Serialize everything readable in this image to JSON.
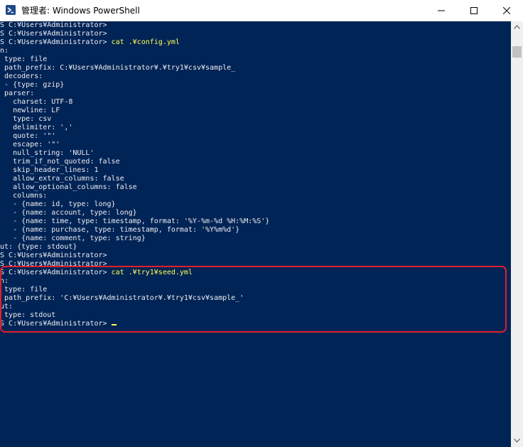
{
  "window": {
    "title": "管理者: Windows PowerShell",
    "icon": "powershell-icon",
    "controls": {
      "minimize_icon": "minimize-icon",
      "maximize_icon": "maximize-icon",
      "close_icon": "close-icon"
    }
  },
  "console": {
    "background": "#012456",
    "foreground": "#eeedf0",
    "command_color": "#ffff55",
    "highlight_color": "#e0202c",
    "lines": [
      {
        "prompt": "PS C:¥Users¥Administrator>",
        "cmd": ""
      },
      {
        "prompt": "PS C:¥Users¥Administrator>",
        "cmd": ""
      },
      {
        "prompt": "PS C:¥Users¥Administrator>",
        "cmd": " cat .¥config.yml"
      },
      {
        "text": "in:"
      },
      {
        "text": "  type: file"
      },
      {
        "text": "  path_prefix: C:¥Users¥Administrator¥.¥try1¥csv¥sample_"
      },
      {
        "text": "  decoders:"
      },
      {
        "text": "  - {type: gzip}"
      },
      {
        "text": "  parser:"
      },
      {
        "text": "    charset: UTF-8"
      },
      {
        "text": "    newline: LF"
      },
      {
        "text": "    type: csv"
      },
      {
        "text": "    delimiter: ','"
      },
      {
        "text": "    quote: '\"'"
      },
      {
        "text": "    escape: '\"'"
      },
      {
        "text": "    null_string: 'NULL'"
      },
      {
        "text": "    trim_if_not_quoted: false"
      },
      {
        "text": "    skip_header_lines: 1"
      },
      {
        "text": "    allow_extra_columns: false"
      },
      {
        "text": "    allow_optional_columns: false"
      },
      {
        "text": "    columns:"
      },
      {
        "text": "    - {name: id, type: long}"
      },
      {
        "text": "    - {name: account, type: long}"
      },
      {
        "text": "    - {name: time, type: timestamp, format: '%Y-%m-%d %H:%M:%S'}"
      },
      {
        "text": "    - {name: purchase, type: timestamp, format: '%Y%m%d'}"
      },
      {
        "text": "    - {name: comment, type: string}"
      },
      {
        "text": "out: {type: stdout}"
      },
      {
        "prompt": "PS C:¥Users¥Administrator>",
        "cmd": ""
      },
      {
        "prompt": "PS C:¥Users¥Administrator>",
        "cmd": ""
      },
      {
        "prompt": "PS C:¥Users¥Administrator>",
        "cmd": " cat .¥try1¥seed.yml"
      },
      {
        "text": "in:"
      },
      {
        "text": "  type: file"
      },
      {
        "text": "  path_prefix: 'C:¥Users¥Administrator¥.¥try1¥csv¥sample_'"
      },
      {
        "text": "out:"
      },
      {
        "text": "  type: stdout"
      },
      {
        "prompt": "PS C:¥Users¥Administrator>",
        "cmd": " ",
        "cursor": true
      }
    ]
  },
  "scrollbar": {
    "up_icon": "scroll-up-arrow-icon",
    "down_icon": "scroll-down-arrow-icon"
  }
}
